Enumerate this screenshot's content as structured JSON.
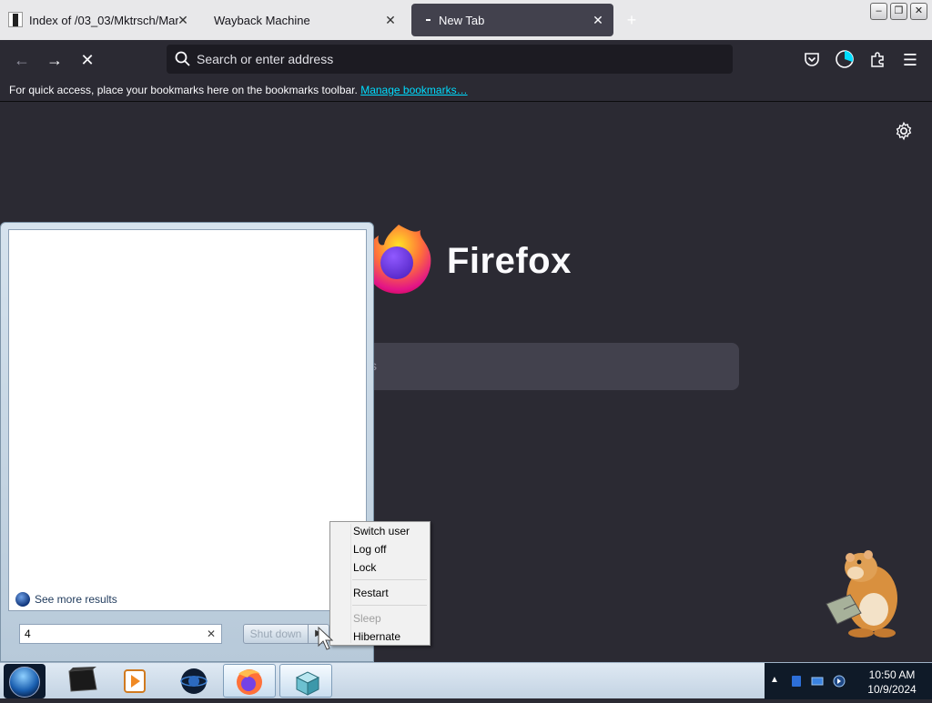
{
  "tabs": [
    {
      "title": "Index of /03_03/Mktrsch/Marke",
      "active": false
    },
    {
      "title": "Wayback Machine",
      "active": false
    },
    {
      "title": "New Tab",
      "active": true
    }
  ],
  "tab_close_glyph": "✕",
  "new_tab_glyph": "+",
  "window_controls": {
    "minimize": "–",
    "restore": "❐",
    "close": "✕"
  },
  "nav": {
    "back_glyph": "←",
    "forward_glyph": "→",
    "stop_glyph": "✕",
    "url_placeholder": "Search or enter address",
    "url_value": "",
    "menu_glyph": "☰"
  },
  "bookmarks_bar": {
    "message": "For quick access, place your bookmarks here on the bookmarks toolbar.",
    "link": "Manage bookmarks…"
  },
  "newtab": {
    "brand": "Firefox",
    "search_placeholder_visible": "ss"
  },
  "start_menu": {
    "see_more": "See more results",
    "search_value": "4",
    "clear_glyph": "✕",
    "shutdown_label": "Shut down",
    "arrow_glyph": "▶"
  },
  "power_menu": {
    "items": [
      {
        "label": "Switch user",
        "enabled": true
      },
      {
        "label": "Log off",
        "enabled": true
      },
      {
        "label": "Lock",
        "enabled": true
      },
      {
        "label": "Restart",
        "enabled": true
      },
      {
        "label": "Sleep",
        "enabled": false
      },
      {
        "label": "Hibernate",
        "enabled": true
      }
    ]
  },
  "taskbar": {
    "tray_up_glyph": "▲",
    "clock_time": "10:50 AM",
    "clock_date": "10/9/2024"
  },
  "colors": {
    "firefox_bg": "#2b2a33",
    "link": "#00ddff",
    "accent_orange": "#ff7139",
    "accent_purple": "#9059ff"
  }
}
